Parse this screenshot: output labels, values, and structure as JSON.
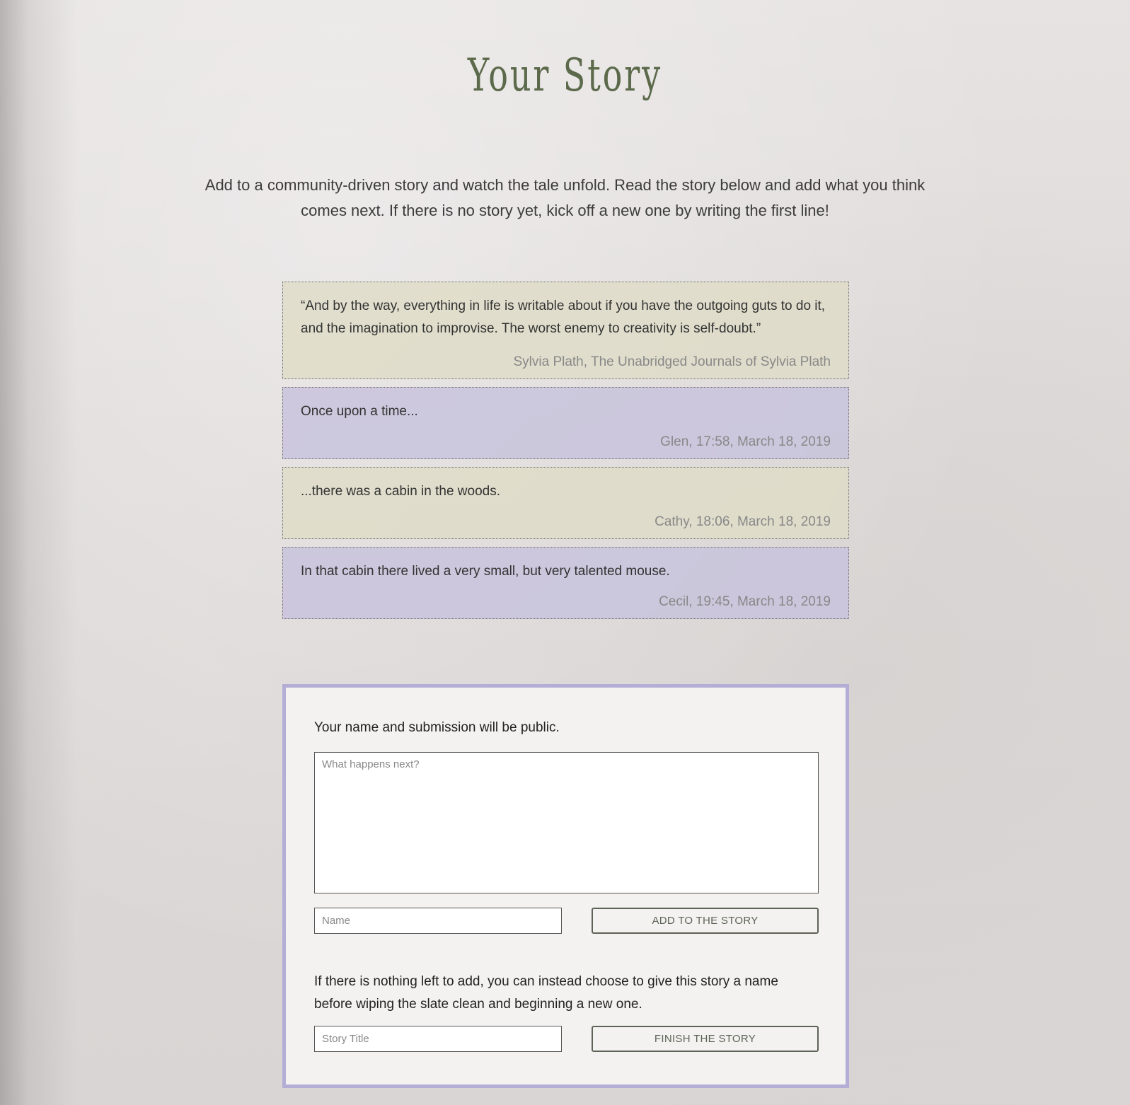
{
  "page": {
    "title": "Your Story",
    "intro": "Add to a community-driven story and watch the tale unfold. Read the story below and add what you think comes next. If there is no story yet, kick off a new one by writing the first line!"
  },
  "quote": {
    "text": "“And by the way, everything in life is writable about if you have the outgoing guts to do it, and the imagination to improvise. The worst enemy to creativity is self-doubt.”",
    "attribution": "Sylvia Plath, The Unabridged Journals of Sylvia Plath"
  },
  "entries": [
    {
      "text": "Once upon a time...",
      "meta": "Glen, 17:58, March 18, 2019"
    },
    {
      "text": "...there was a cabin in the woods.",
      "meta": "Cathy, 18:06, March 18, 2019"
    },
    {
      "text": "In that cabin there lived a very small, but very talented mouse.",
      "meta": "Cecil, 19:45, March 18, 2019"
    }
  ],
  "form": {
    "notice": "Your name and submission will be public.",
    "next_placeholder": "What happens next?",
    "next_value": "",
    "name_placeholder": "Name",
    "name_value": "",
    "add_label": "Add to the story",
    "finish_note": "If there is nothing left to add, you can instead choose to give this story a name before wiping the slate clean and beginning a new one.",
    "title_placeholder": "Story Title",
    "title_value": "",
    "finish_label": "Finish the story"
  },
  "colors": {
    "title": "#5c6a4b",
    "tan_card": "#dfdcc8",
    "lavender_card": "#c8c3dc",
    "form_border": "#b4aed6",
    "button_border": "#5d6357"
  }
}
